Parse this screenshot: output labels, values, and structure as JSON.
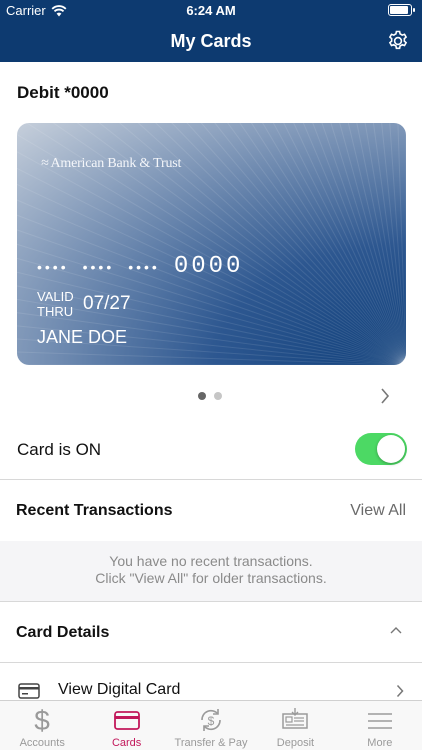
{
  "status_bar": {
    "carrier": "Carrier",
    "time": "6:24 AM"
  },
  "header": {
    "title": "My Cards"
  },
  "card": {
    "title": "Debit *0000",
    "bank_name": "American Bank & Trust",
    "masked_groups": [
      "••••",
      "••••",
      "••••"
    ],
    "last_four": "0000",
    "valid_thru_label_1": "VALID",
    "valid_thru_label_2": "THRU",
    "expiry": "07/27",
    "holder": "JANE DOE"
  },
  "pager": {
    "count": 2,
    "active_index": 0
  },
  "card_toggle": {
    "label": "Card is ON",
    "on": true
  },
  "recent_transactions": {
    "title": "Recent Transactions",
    "view_all": "View All",
    "empty_line_1": "You have no recent transactions.",
    "empty_line_2": "Click \"View All\" for older transactions."
  },
  "card_details": {
    "title": "Card Details",
    "items": [
      {
        "label": "View Digital Card",
        "icon": "credit-card-icon"
      }
    ]
  },
  "tabbar": {
    "tabs": [
      {
        "label": "Accounts",
        "icon": "dollar-icon"
      },
      {
        "label": "Cards",
        "icon": "card-icon"
      },
      {
        "label": "Transfer & Pay",
        "icon": "transfer-icon"
      },
      {
        "label": "Deposit",
        "icon": "check-deposit-icon"
      },
      {
        "label": "More",
        "icon": "menu-icon"
      }
    ],
    "active": 1
  },
  "colors": {
    "header": "#0d3a70",
    "accent": "#c2185b",
    "toggle_on": "#4cd964"
  }
}
